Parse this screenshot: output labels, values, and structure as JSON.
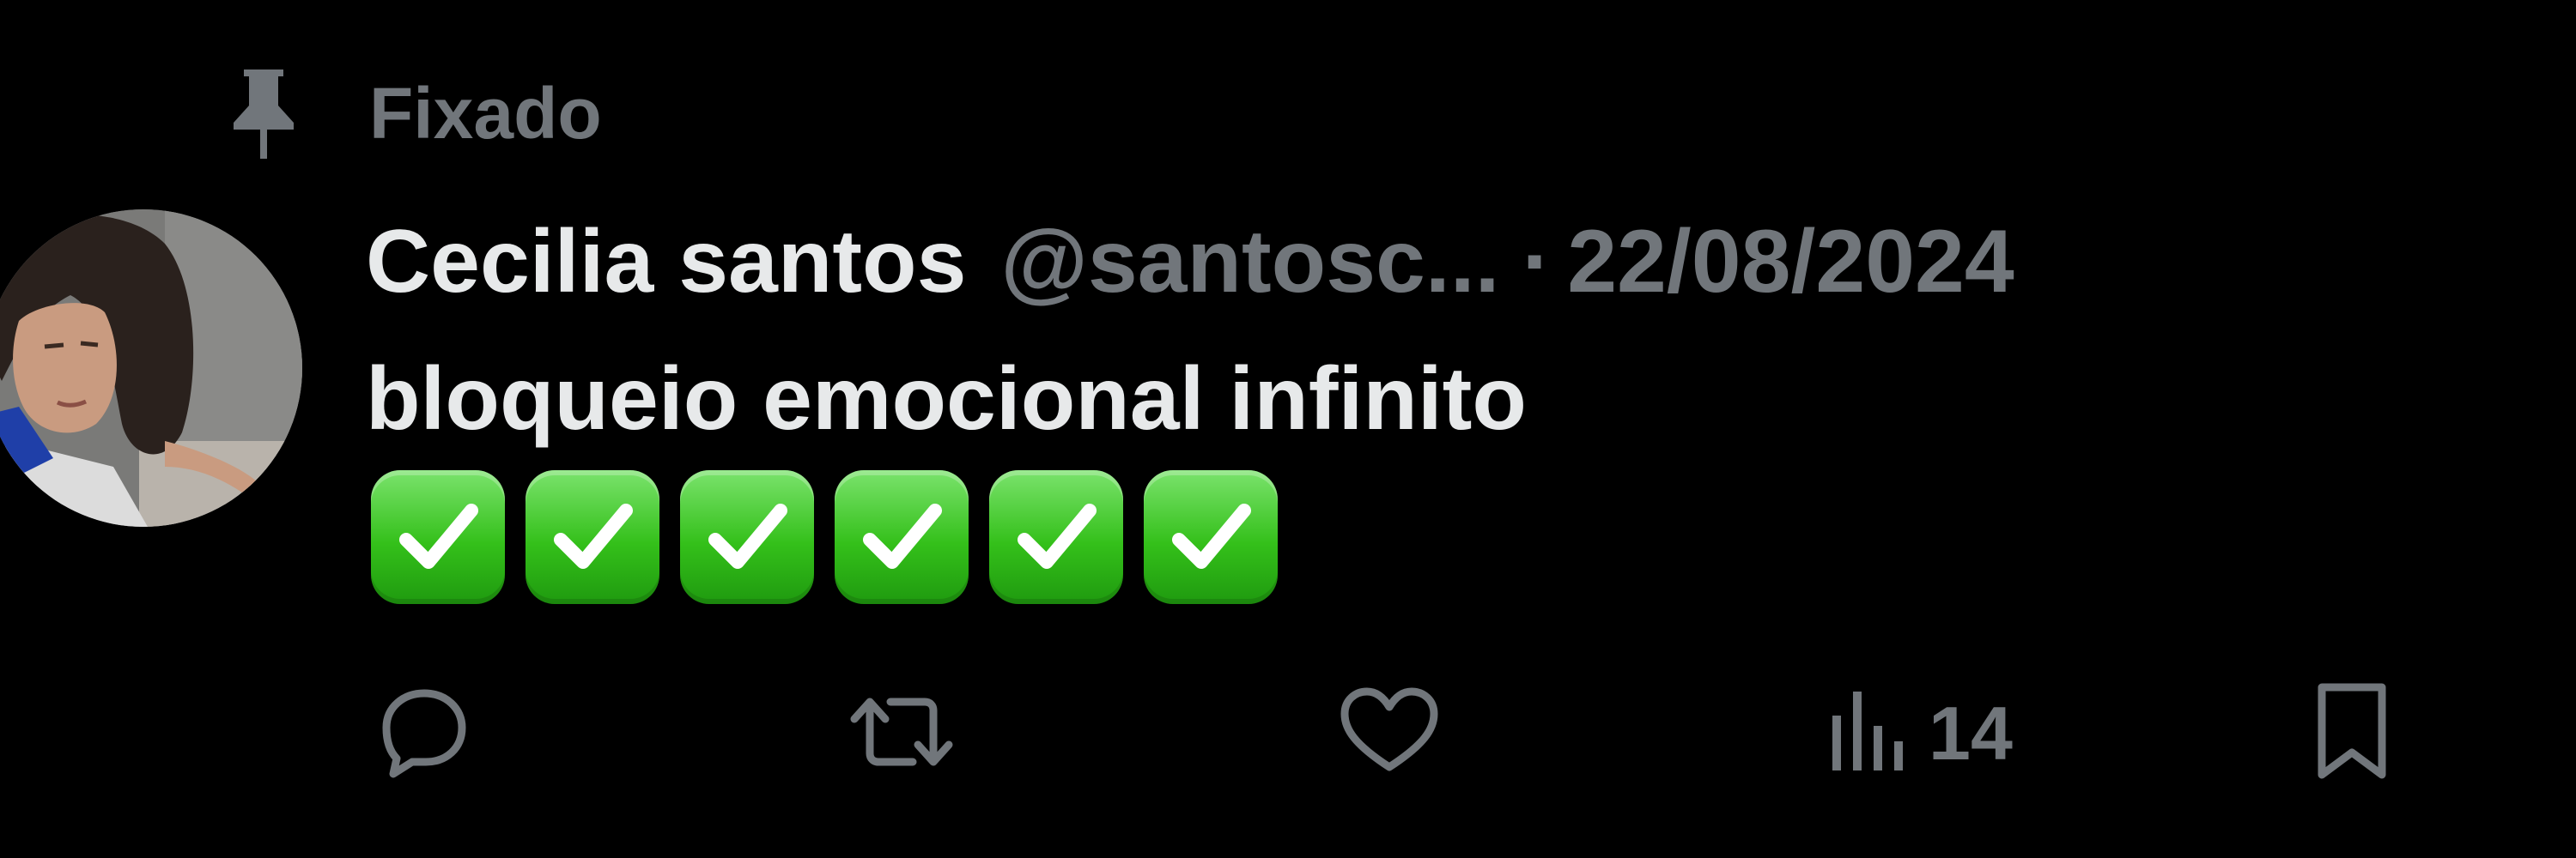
{
  "pinned": {
    "label": "Fixado",
    "icon": "pin-icon"
  },
  "tweet": {
    "author_name": "Cecilia santos",
    "handle": "@santosc...",
    "separator": "·",
    "date": "22/08/2024",
    "text": "bloqueio emocional infinito",
    "emojis": [
      "✅",
      "✅",
      "✅",
      "✅",
      "✅",
      "✅"
    ]
  },
  "actions": {
    "reply": {
      "icon": "reply-icon"
    },
    "retweet": {
      "icon": "retweet-icon"
    },
    "like": {
      "icon": "heart-icon"
    },
    "views": {
      "icon": "views-icon",
      "count": "14"
    },
    "bookmark": {
      "icon": "bookmark-icon"
    }
  },
  "colors": {
    "background": "#000000",
    "primary_text": "#e7e9ea",
    "secondary_text": "#71767b",
    "check_green": "#34c01a"
  }
}
